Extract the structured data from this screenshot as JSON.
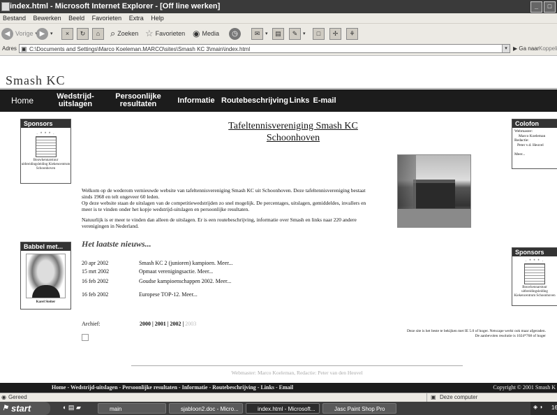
{
  "window": {
    "title": "index.html - Microsoft Internet Explorer - [Off line werken]",
    "buttons": [
      "_",
      "□"
    ]
  },
  "menu": [
    "Bestand",
    "Bewerken",
    "Beeld",
    "Favorieten",
    "Extra",
    "Help"
  ],
  "toolbar": {
    "back": "Vorige",
    "search": "Zoeken",
    "favorites": "Favorieten",
    "media": "Media"
  },
  "address": {
    "label": "Adres",
    "url": "C:\\Documents and Settings\\Marco Koeleman.MARCO\\sites\\Smash KC 3\\main\\index.html",
    "go": "Ga naar",
    "links": "Koppelingen"
  },
  "site": {
    "title": "Smash KC",
    "nav": [
      "Home",
      "Wedstrijd-\nuitslagen",
      "Persoonlijke\nresultaten",
      "Informatie",
      "Routebeschrijving",
      "Links",
      "E-mail"
    ]
  },
  "sponsors_left": {
    "head": "Sponsors",
    "logo_stars": "· * * * ·",
    "caption": "Bouwkennarstuur uitbreidingsleiding Kiekencentrum Schoonhoven"
  },
  "babbel": {
    "head": "Babbel met...",
    "caption": "Karel Steiter"
  },
  "main": {
    "heading_line1": "Tafeltennisvereniging Smash KC",
    "heading_line2": "Schoonhoven",
    "intro1": "Welkom op de wederom vernieuwde website van tafeltennisvereniging Smash KC uit Schoonhoven. Deze tafeltennisvereniging bestaat sinds 1968 en telt ongeveer 60 leden.",
    "intro2": "Op deze website staan de uitslagen van de competitiewedstrijden zo snel mogelijk. De percentages, uitslagen, gemiddeldes, invallers en meer is te vinden onder het kopje wedstrijd-uitslagen en persoonlijke resultaten.",
    "intro3": "Natuurlijk is er meer te vinden dan alleen de uitslagen. Er is een routebeschrijving, informatie over Smash en links naar 220 andere verenigingen in Nederland.",
    "news_heading": "Het laatste nieuws...",
    "news": [
      {
        "date": "20 apr 2002",
        "text": "Smash KC 2 (junioren) kampioen. Meer..."
      },
      {
        "date": "15 mrt 2002",
        "text": "Opmaat verenigingsactie. Meer..."
      },
      {
        "date": "16 feb 2002",
        "text": "Goudse kampioenschappen 2002. Meer..."
      },
      {
        "date": "16 feb 2002",
        "text": "Europese TOP-12. Meer..."
      }
    ],
    "archive_label": "Archief:",
    "archive_years": [
      "2000",
      "2001",
      "2002",
      "2003"
    ],
    "footer_text": "Webmaster: Marco Koeleman,  Redactie: Peter van den Heuvel",
    "browser_note": "Deze site is het beste te bekijken met IE 5.0 of hoger. Netscape werkt ook maar afgeraden. De aanbevolen resolutie is 1024*768 of hoger"
  },
  "colofon": {
    "head": "Colofon",
    "webmaster_label": "Webmaster:",
    "webmaster": "Marco Koeleman",
    "redactie_label": "Redactie:",
    "redactie": "Peter v.d. Heuvel",
    "more": "Meer..."
  },
  "sponsors_right": {
    "head": "Sponsors",
    "logo_stars": "· * * * ·",
    "caption": "Bouwkennarstuur uitbreidingsleiding Kiekencentrum Schoonhoven"
  },
  "bottom_nav": "Home - Wedstrijd-uitslagen - Persoonlijke resultaten - Informatie - Routebeschrijving - Links - Email",
  "copyright": "Copyright © 2001 Smash K",
  "status": {
    "left": "Gereed",
    "zone": "Deze computer"
  },
  "taskbar": {
    "start": "start",
    "tasks": [
      "main",
      "sjabloon2.doc - Micro...",
      "index.html - Microsoft...",
      "Jasc Paint Shop Pro"
    ],
    "clock": "16"
  }
}
